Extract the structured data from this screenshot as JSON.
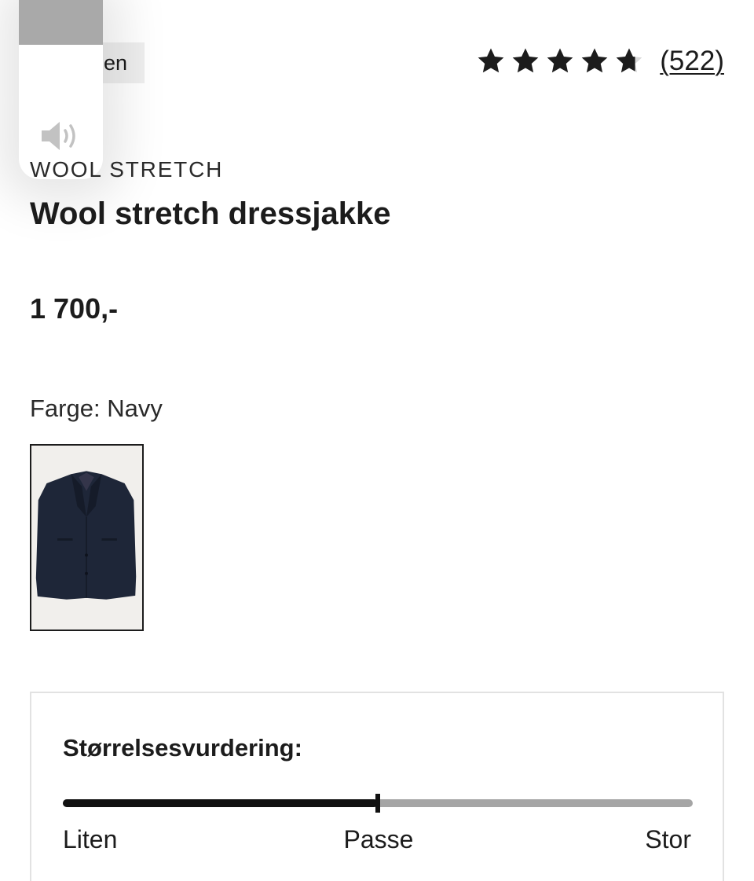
{
  "badge": {
    "label": "en"
  },
  "rating": {
    "value": 4.7,
    "max": 5,
    "count_label": "(522)",
    "star_icon": "star-icon"
  },
  "volume": {
    "level": 0.25,
    "icon": "speaker-icon"
  },
  "product": {
    "brand": "WOOL STRETCH",
    "title": "Wool stretch dressjakke",
    "price": "1 700,-",
    "color_label": "Farge: Navy"
  },
  "fit": {
    "title": "Størrelsesvurdering:",
    "position": 0.5,
    "min_label": "Liten",
    "mid_label": "Passe",
    "max_label": "Stor"
  },
  "colors": {
    "text": "#1c1c1c",
    "track": "#a5a5a5",
    "track_fill": "#111111",
    "jacket": "#1e2638"
  }
}
